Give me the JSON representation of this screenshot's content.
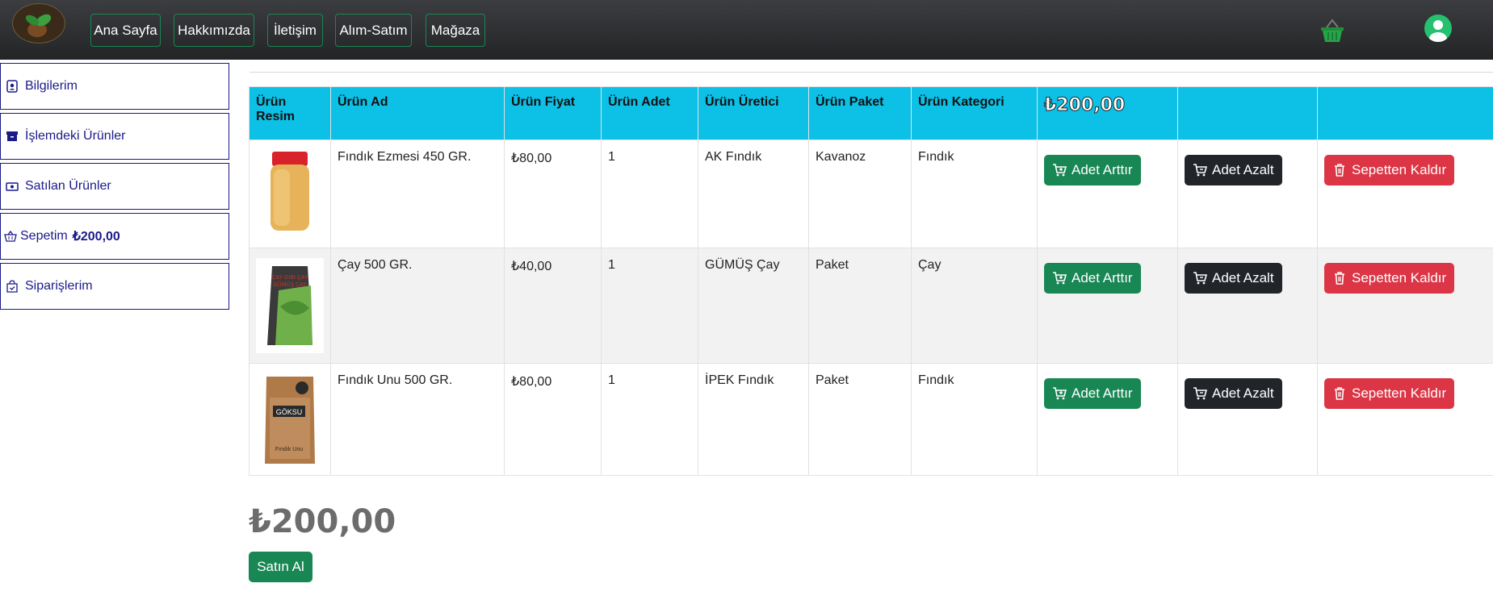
{
  "nav": {
    "links": [
      "Ana Sayfa",
      "Hakkımızda",
      "İletişim",
      "Alım-Satım",
      "Mağaza"
    ]
  },
  "sidebar": {
    "items": [
      {
        "label": "Bilgilerim",
        "icon": "person-badge-icon"
      },
      {
        "label": "İşlemdeki Ürünler",
        "icon": "archive-icon"
      },
      {
        "label": "Satılan Ürünler",
        "icon": "cash-icon"
      },
      {
        "label": "Sepetim",
        "icon": "basket-icon",
        "amount": "₺200,00"
      },
      {
        "label": "Siparişlerim",
        "icon": "bag-check-icon"
      }
    ]
  },
  "table": {
    "headers": [
      "Ürün Resim",
      "Ürün Ad",
      "Ürün Fiyat",
      "Ürün Adet",
      "Ürün Üretici",
      "Ürün Paket",
      "Ürün Kategori",
      "₺200,00",
      "",
      ""
    ],
    "rows": [
      {
        "name": "Fındık Ezmesi 450 GR.",
        "price": "₺80,00",
        "qty": "1",
        "producer": "AK Fındık",
        "package": "Kavanoz",
        "category": "Fındık"
      },
      {
        "name": "Çay 500 GR.",
        "price": "₺40,00",
        "qty": "1",
        "producer": "GÜMÜŞ Çay",
        "package": "Paket",
        "category": "Çay"
      },
      {
        "name": "Fındık Unu 500 GR.",
        "price": "₺80,00",
        "qty": "1",
        "producer": "İPEK Fındık",
        "package": "Paket",
        "category": "Fındık"
      }
    ],
    "buttons": {
      "increase": "Adet Arttır",
      "decrease": "Adet Azalt",
      "remove": "Sepetten Kaldır"
    },
    "image_text": {
      "tea_line1": "ÇAY GİBİ ÇAY",
      "tea_line2": "GÜMÜŞ ÇAY",
      "flour_brand": "GÖKSU",
      "flour_label": "Fındık Unu"
    }
  },
  "total": "₺200,00",
  "buy_label": "Satın Al",
  "colors": {
    "accent": "#198754",
    "header": "#0dc0e6",
    "danger": "#dc3545",
    "dark": "#212529",
    "sidebar": "#1a1a8a"
  }
}
